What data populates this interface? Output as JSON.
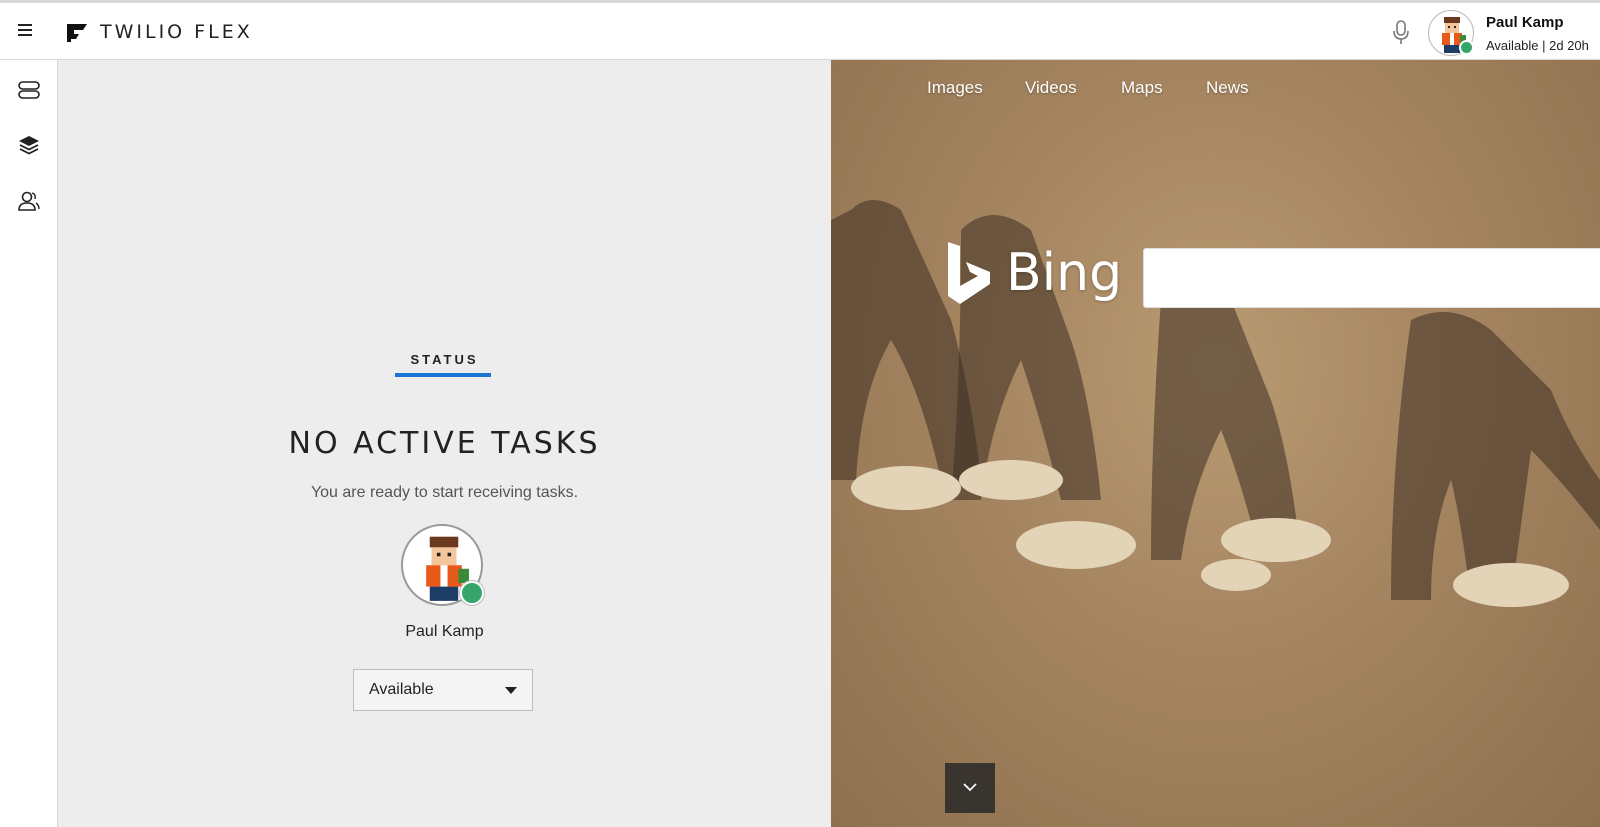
{
  "header": {
    "brand": "TWILIO FLEX",
    "user_name": "Paul Kamp",
    "user_status": "Available | 2d 20h"
  },
  "leftnav": {
    "items": [
      {
        "icon": "agent-desktop-icon"
      },
      {
        "icon": "layers-icon"
      },
      {
        "icon": "teams-icon"
      }
    ]
  },
  "main": {
    "status_label": "STATUS",
    "heading": "NO ACTIVE TASKS",
    "subtext": "You are ready to start receiving tasks.",
    "agent_name": "Paul Kamp",
    "activity_selected": "Available"
  },
  "bing": {
    "nav": [
      "Images",
      "Videos",
      "Maps",
      "News"
    ],
    "logo_text": "Bing",
    "search_value": ""
  },
  "colors": {
    "accent_blue": "#1976d2",
    "available_green": "#36a56b",
    "panel_bg": "#ededed"
  }
}
